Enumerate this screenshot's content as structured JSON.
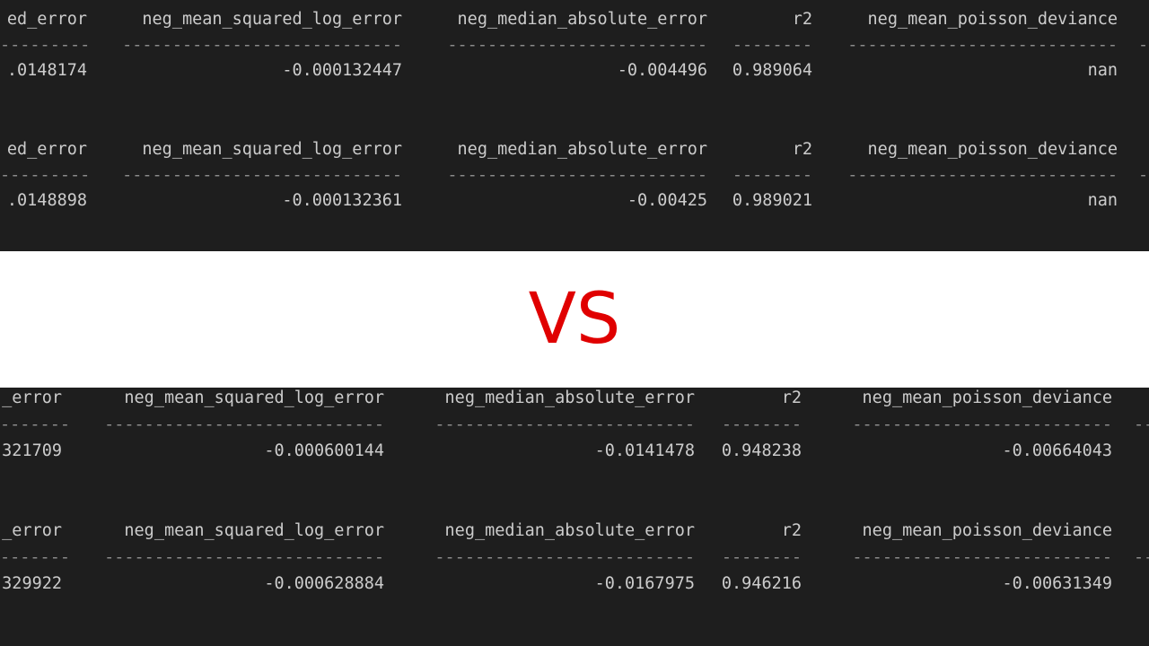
{
  "separator_label": "VS",
  "colors": {
    "panel_bg": "#1e1e1e",
    "text": "#cccccc",
    "accent": "#e00000"
  },
  "top": {
    "headers": [
      "ed_error",
      "neg_mean_squared_log_error",
      "neg_median_absolute_error",
      "r2",
      "neg_mean_poisson_deviance"
    ],
    "dashes": [
      "---------",
      "----------------------------",
      "--------------------------",
      "--------",
      "---------------------------",
      "-"
    ],
    "row1": [
      ".0148174",
      "-0.000132447",
      "-0.004496",
      "0.989064",
      "nan"
    ],
    "row2": [
      ".0148898",
      "-0.000132361",
      "-0.00425",
      "0.989021",
      "nan"
    ]
  },
  "bottom": {
    "headers": [
      "_error",
      "neg_mean_squared_log_error",
      "neg_median_absolute_error",
      "r2",
      "neg_mean_poisson_deviance"
    ],
    "dashes": [
      "-------",
      "----------------------------",
      "--------------------------",
      "--------",
      "--------------------------",
      "--"
    ],
    "row1": [
      "321709",
      "-0.000600144",
      "-0.0141478",
      "0.948238",
      "-0.00664043"
    ],
    "row2": [
      "329922",
      "-0.000628884",
      "-0.0167975",
      "0.946216",
      "-0.00631349"
    ]
  }
}
